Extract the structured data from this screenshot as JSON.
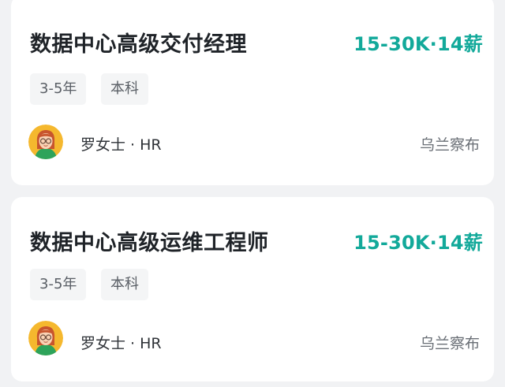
{
  "jobs": [
    {
      "title": "数据中心高级交付经理",
      "salary": "15-30K·14薪",
      "tags": [
        "3-5年",
        "本科"
      ],
      "recruiter": "罗女士 · HR",
      "location": "乌兰察布"
    },
    {
      "title": "数据中心高级运维工程师",
      "salary": "15-30K·14薪",
      "tags": [
        "3-5年",
        "本科"
      ],
      "recruiter": "罗女士 · HR",
      "location": "乌兰察布"
    }
  ],
  "colors": {
    "salary": "#12a99a",
    "card_background": "#ffffff",
    "page_background": "#f1f2f4",
    "avatar_background": "#f5b82e"
  },
  "icons": {
    "avatar": "recruiter-avatar-woman-with-glasses"
  }
}
